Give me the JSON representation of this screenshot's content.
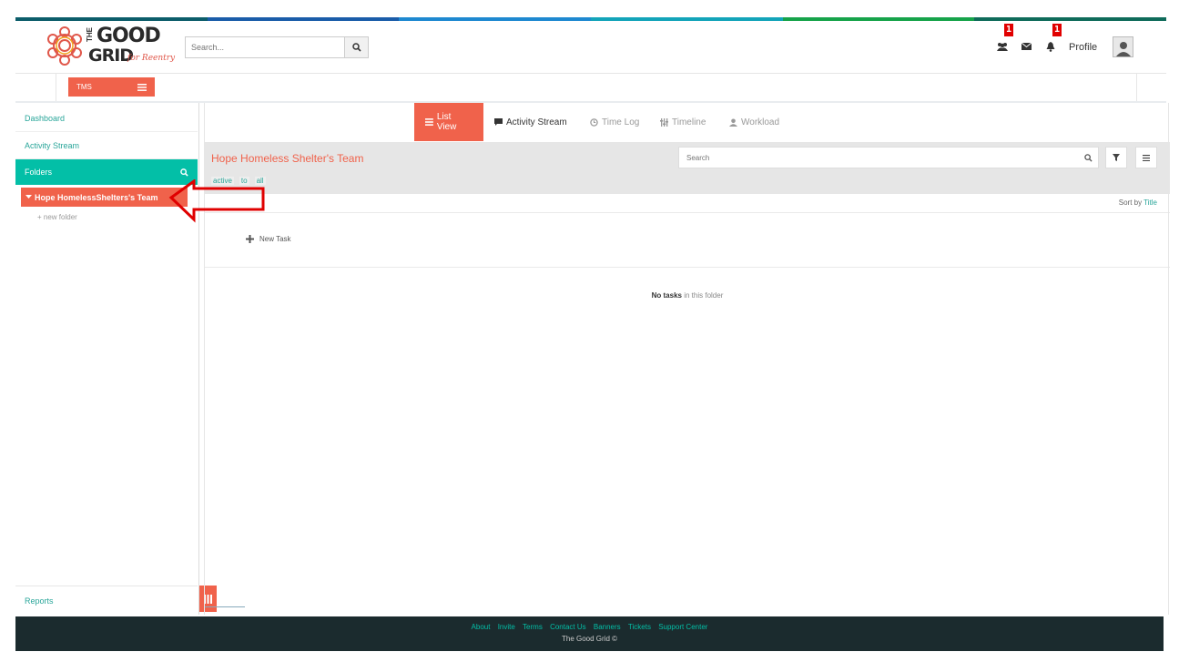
{
  "colors": {
    "accent": "#f0624b",
    "teal": "#03bfa7",
    "strip": [
      "#0c5d6a",
      "#1a5ca9",
      "#1e88d0",
      "#13a4b9",
      "#16a34a",
      "#0f6b5a"
    ]
  },
  "header": {
    "logo_top": "THE",
    "logo_main1": "GOOD",
    "logo_main2": "GRID",
    "logo_script": "for Reentry",
    "search_placeholder": "Search...",
    "badge_team": "1",
    "badge_notifications": "1",
    "profile_label": "Profile"
  },
  "subbar": {
    "tms_label": "TMS"
  },
  "sidebar": {
    "dashboard": "Dashboard",
    "activity_stream": "Activity Stream",
    "folders": "Folders",
    "active_folder": "Hope HomelessShelters's Team",
    "new_folder": "+ new folder",
    "reports": "Reports"
  },
  "tabs": {
    "list_view": "List View",
    "activity_stream": "Activity Stream",
    "time_log": "Time Log",
    "timeline": "Timeline",
    "workload": "Workload"
  },
  "main": {
    "team_title": "Hope Homeless Shelter's Team",
    "search_placeholder": "Search",
    "filter_active": "active",
    "filter_todo": "to",
    "filter_all": "all",
    "sort_prefix": "Sort by",
    "sort_field": "Title",
    "new_task": "New Task",
    "no_tasks_bold": "No tasks",
    "no_tasks_rest": "in this folder"
  },
  "footer": {
    "links": [
      "About",
      "Invite",
      "Terms",
      "Contact Us",
      "Banners",
      "Tickets",
      "Support Center"
    ],
    "copyright": "The Good Grid ©"
  }
}
